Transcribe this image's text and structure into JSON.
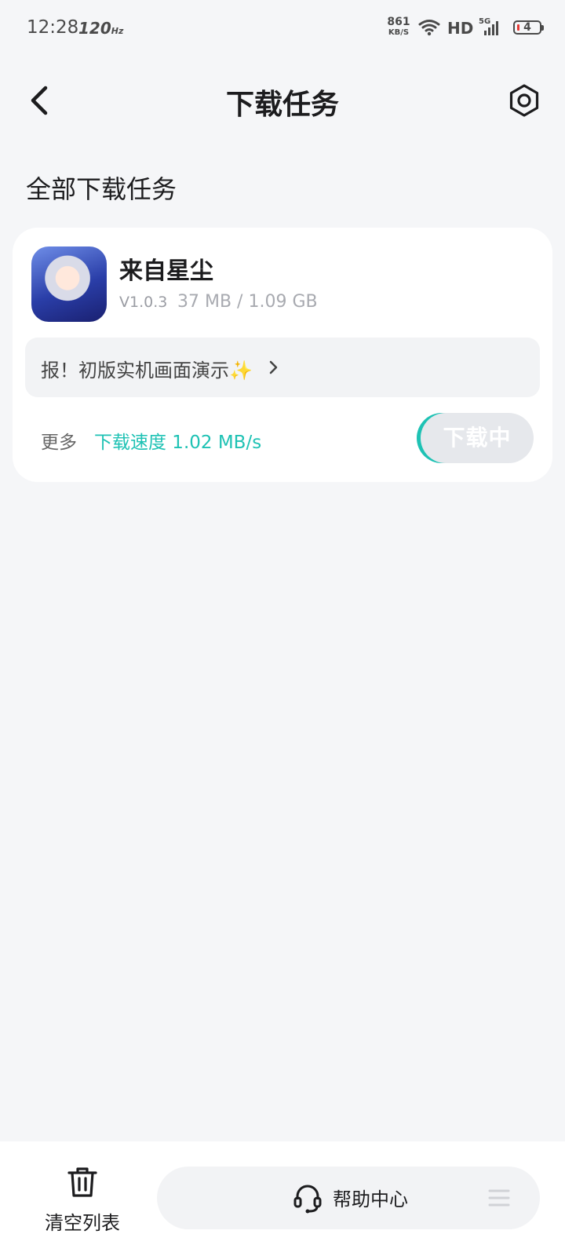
{
  "status_bar": {
    "time": "12:28",
    "refresh_rate": "120",
    "refresh_unit": "Hz",
    "net_speed": "861",
    "net_speed_unit": "KB/S",
    "hd_label": "HD",
    "network_label": "5G",
    "battery_level": "4",
    "icons": [
      "wifi-icon",
      "signal-icon",
      "battery-icon"
    ]
  },
  "header": {
    "title": "下载任务",
    "back_icon": "chevron-left-icon",
    "settings_icon": "settings-hexagon-icon"
  },
  "section": {
    "title": "全部下载任务"
  },
  "task": {
    "app_name": "来自星尘",
    "version": "V1.0.3",
    "size_progress": "37 MB / 1.09 GB",
    "downloaded_mb": 37,
    "total_gb": 1.09,
    "news": "报！初版实机画面演示✨",
    "more_label": "更多",
    "speed_text": "下载速度 1.02 MB/s",
    "status_button": "下载中"
  },
  "bottom_bar": {
    "clear_label": "清空列表",
    "help_label": "帮助中心",
    "icons": [
      "trash-icon",
      "headset-icon",
      "menu-icon"
    ]
  },
  "colors": {
    "accent": "#1ec2b4",
    "background": "#f5f6f8",
    "card": "#ffffff"
  }
}
